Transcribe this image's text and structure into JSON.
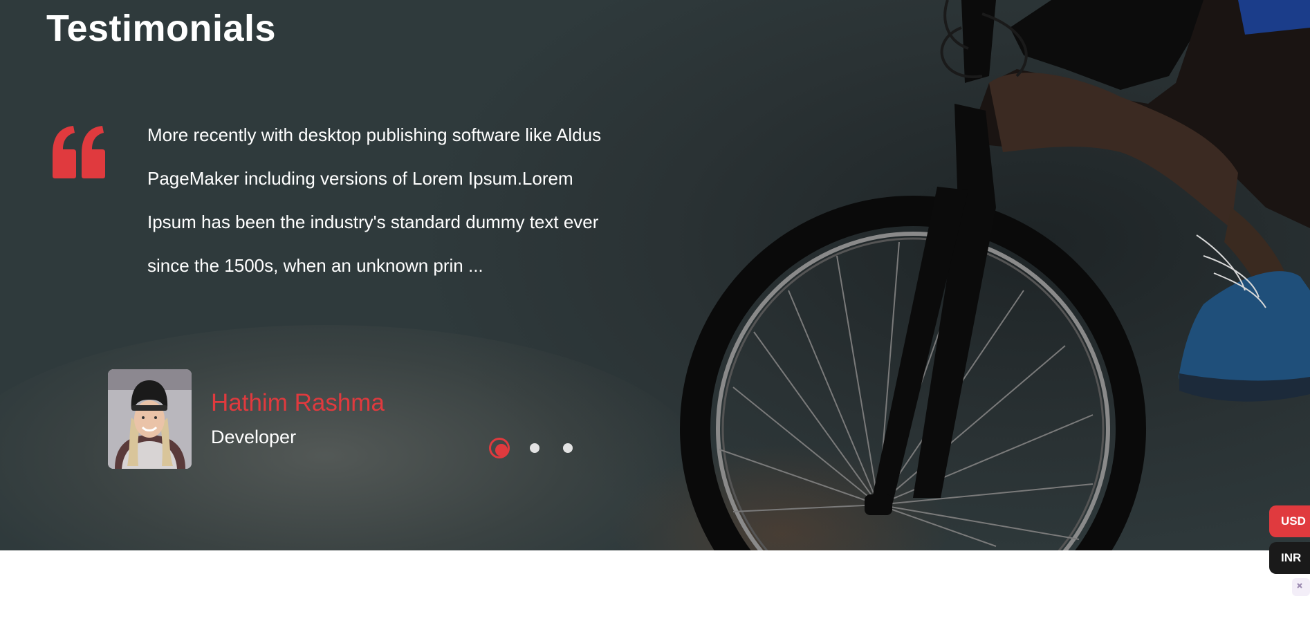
{
  "section": {
    "title": "Testimonials"
  },
  "testimonial": {
    "quote": "More recently with desktop publishing software like Aldus PageMaker including versions of Lorem Ipsum.Lorem Ipsum has been the industry's standard dummy text ever since the 1500s, when an unknown prin ...",
    "author_name": "Hathim Rashma",
    "author_role": "Developer"
  },
  "carousel": {
    "total": 3,
    "active_index": 0
  },
  "currency": {
    "options": [
      "USD",
      "INR"
    ],
    "selected": "USD"
  },
  "colors": {
    "accent": "#e03a3e",
    "dark_button": "#1a1a1a",
    "text_light": "#ffffff"
  },
  "icons": {
    "quote": "quote-mark-icon",
    "corner": "widget-icon"
  }
}
